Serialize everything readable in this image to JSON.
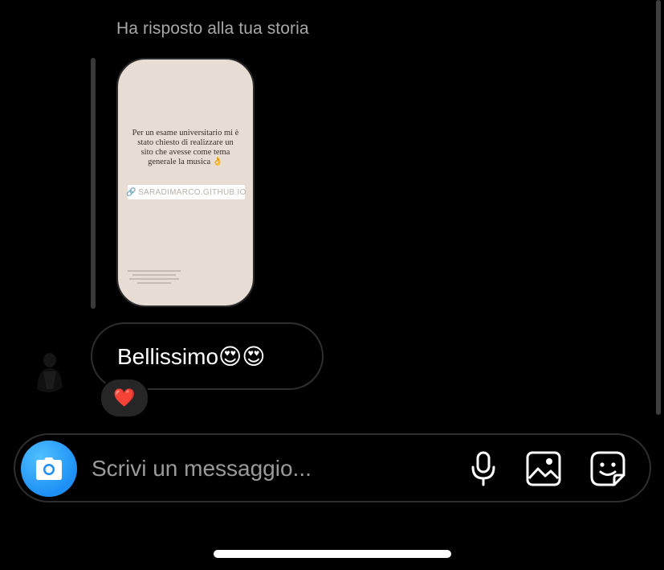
{
  "thread": {
    "reply_header": "Ha risposto alla tua storia",
    "story": {
      "text": "Per un esame universitario mi è stato chiesto di realizzare un sito che avesse come tema generale la musica 👌",
      "link_label": "SARADIMARCO.GITHUB.IO",
      "link_icon": "link-icon"
    },
    "message": {
      "text": "Bellissimo😍😍",
      "reaction": "❤️"
    }
  },
  "composer": {
    "placeholder": "Scrivi un messaggio...",
    "camera_icon": "camera-icon",
    "mic_icon": "microphone-icon",
    "gallery_icon": "image-icon",
    "sticker_icon": "sticker-icon"
  },
  "colors": {
    "background": "#000000",
    "camera_button": "#1e90f5",
    "bubble_border": "#2e2e2e",
    "reaction_bg": "#262626",
    "secondary_text": "#a8a8a8"
  }
}
